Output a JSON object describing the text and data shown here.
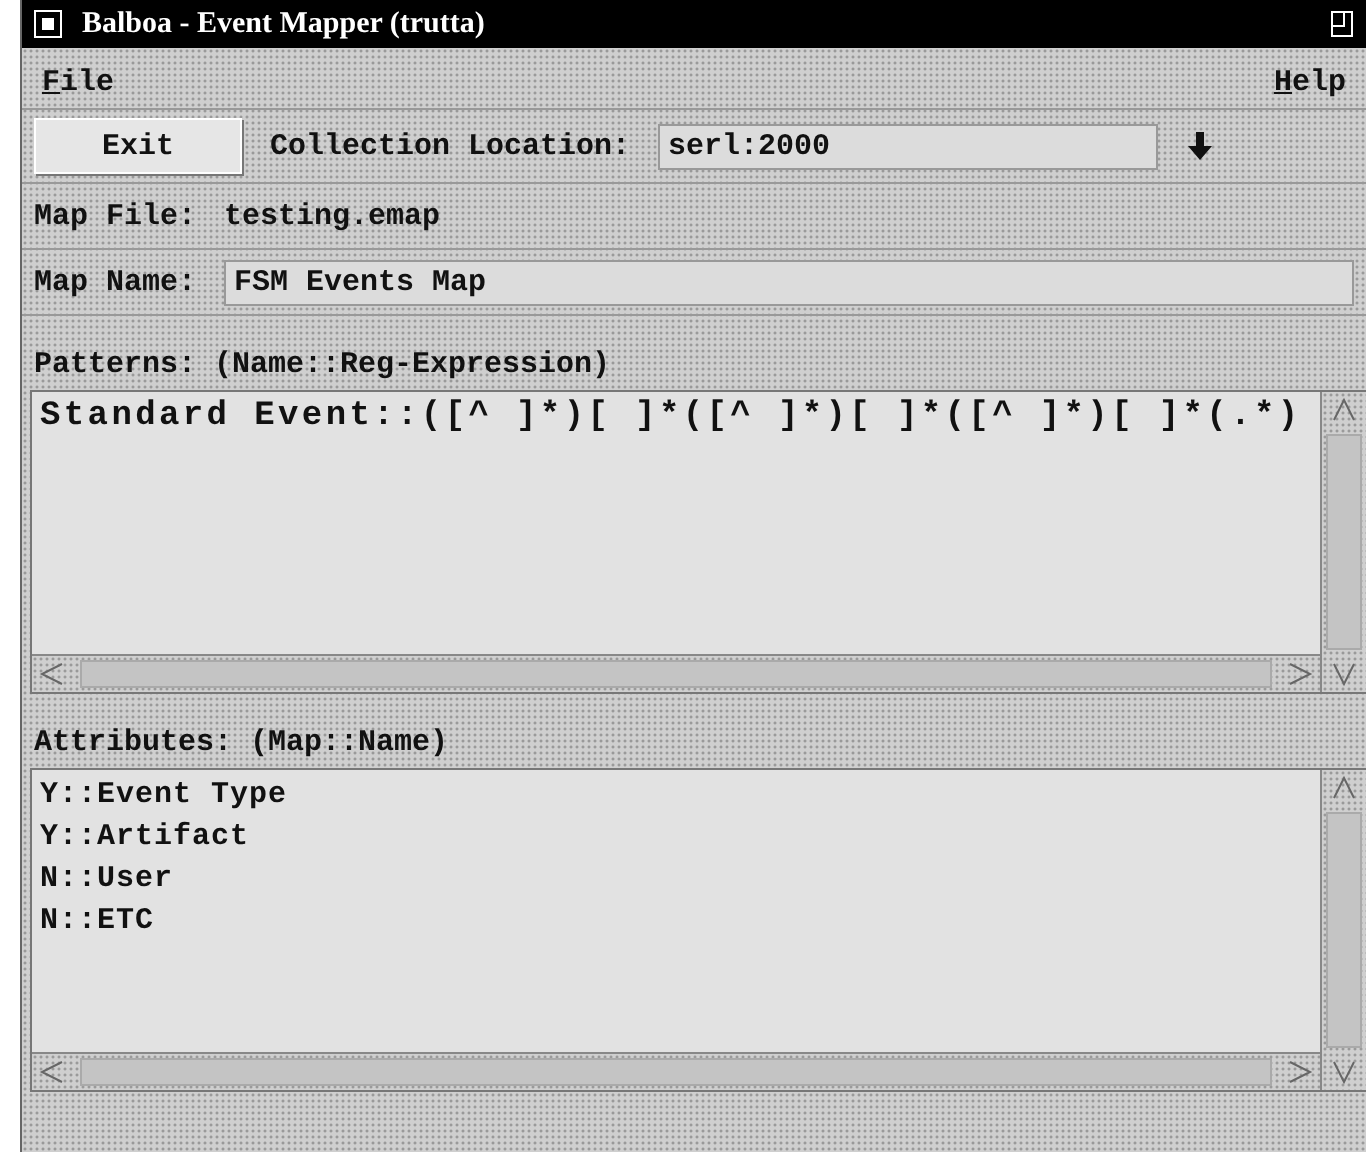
{
  "window": {
    "title": "Balboa - Event Mapper (trutta)"
  },
  "menu": [
    {
      "label": "File"
    },
    {
      "label": "Help"
    }
  ],
  "toolbar": {
    "exit_button": "Exit",
    "collection_location": {
      "label": "Collection Location:",
      "value": "serl:2000"
    }
  },
  "map_file": {
    "label": "Map File:",
    "value": "testing.emap"
  },
  "map_name": {
    "label": "Map Name:",
    "value": "FSM Events Map"
  },
  "patterns": {
    "label": "Patterns: (Name::Reg-Expression)",
    "lines": [
      "Standard Event::([^ ]*)[ ]*([^ ]*)[ ]*([^ ]*)[ ]*(.*)"
    ]
  },
  "attributes": {
    "label": "Attributes: (Map::Name)",
    "items": [
      "Y::Event Type",
      "Y::Artifact",
      "N::User",
      "N::ETC"
    ]
  }
}
